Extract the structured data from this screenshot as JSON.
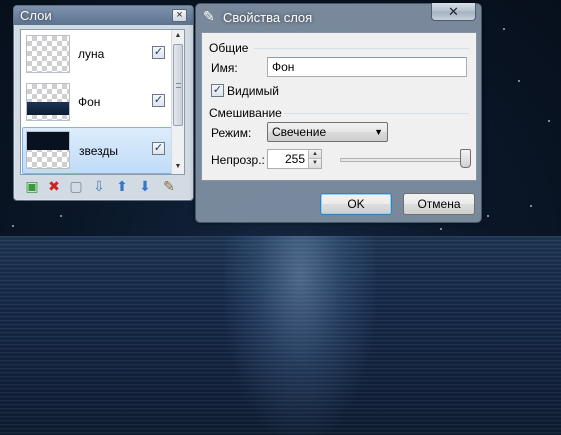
{
  "layers_panel": {
    "title": "Слои",
    "close_glyph": "×",
    "layers": [
      {
        "name": "луна",
        "visible": true,
        "selected": false,
        "visible_glyph": "✓"
      },
      {
        "name": "Фон",
        "visible": true,
        "selected": false,
        "visible_glyph": "✓"
      },
      {
        "name": "звезды",
        "visible": true,
        "selected": true,
        "visible_glyph": "✓"
      }
    ],
    "toolbar": [
      {
        "icon": "add-layer-icon",
        "glyph": "▣",
        "color": "#3a9a3a"
      },
      {
        "icon": "delete-layer-icon",
        "glyph": "✖",
        "color": "#d02020"
      },
      {
        "icon": "duplicate-layer-icon",
        "glyph": "▢",
        "color": "#7a8794"
      },
      {
        "icon": "merge-down-icon",
        "glyph": "⇩",
        "color": "#4d7db8"
      },
      {
        "icon": "move-up-icon",
        "glyph": "⬆",
        "color": "#2f78cc"
      },
      {
        "icon": "move-down-icon",
        "glyph": "⬇",
        "color": "#2f78cc"
      },
      {
        "icon": "properties-icon",
        "glyph": "✎",
        "color": "#8a6d3b"
      }
    ]
  },
  "dialog": {
    "title": "Свойства слоя",
    "close_glyph": "✕",
    "general_label": "Общие",
    "name_label": "Имя:",
    "name_value": "Фон",
    "visible_label": "Видимый",
    "visible_checked": true,
    "visible_glyph": "✓",
    "blending_label": "Смешивание",
    "mode_label": "Режим:",
    "mode_value": "Свечение",
    "mode_arrow": "▼",
    "opacity_label": "Непрозр.:",
    "opacity_value": "255",
    "opacity_fraction": 1.0,
    "spin_up_glyph": "▲",
    "spin_down_glyph": "▼",
    "ok_label": "OK",
    "cancel_label": "Отмена"
  },
  "colors": {
    "titlebar": "#5b7290",
    "selection": "#c1dcf7",
    "background_sky": "#0a1627",
    "background_sea": "#15294a"
  }
}
